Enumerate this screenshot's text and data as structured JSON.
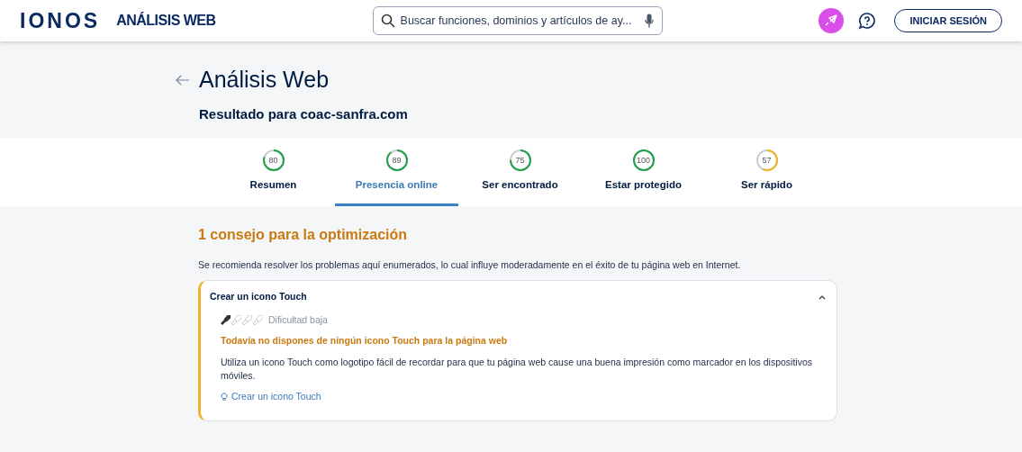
{
  "header": {
    "logo": "IONOS",
    "product": "ANÁLISIS WEB",
    "search": {
      "placeholder": "Buscar funciones, dominios y artículos de ay..."
    },
    "login": "INICIAR SESIÓN"
  },
  "title": "Análisis Web",
  "subtitle": "Resultado para coac-sanfra.com",
  "tabs": [
    {
      "score": "80",
      "color": "#22a04b",
      "label": "Resumen",
      "selected": false
    },
    {
      "score": "89",
      "color": "#22a04b",
      "label": "Presencia online",
      "selected": true
    },
    {
      "score": "75",
      "color": "#22a04b",
      "label": "Ser encontrado",
      "selected": false
    },
    {
      "score": "100",
      "color": "#22a04b",
      "label": "Estar protegido",
      "selected": false
    },
    {
      "score": "57",
      "color": "#f0b429",
      "label": "Ser rápido",
      "selected": false
    }
  ],
  "section": {
    "heading": "1 consejo para la optimización",
    "intro": "Se recomienda resolver los problemas aquí enumerados, lo cual influye moderadamente en el éxito de tu página web en Internet.",
    "cards": [
      {
        "title": "Crear un icono Touch",
        "expanded": true,
        "stars": 1,
        "difficulty": "Dificultad baja",
        "problem": "Todavía no dispones de ningún icono Touch para la página web",
        "text": "Utiliza un icono Touch como logotipo fácil de recordar para que tu página web cause una buena impresión como marcador en los dispositivos móviles.",
        "link": "Crear un icono Touch"
      }
    ]
  }
}
